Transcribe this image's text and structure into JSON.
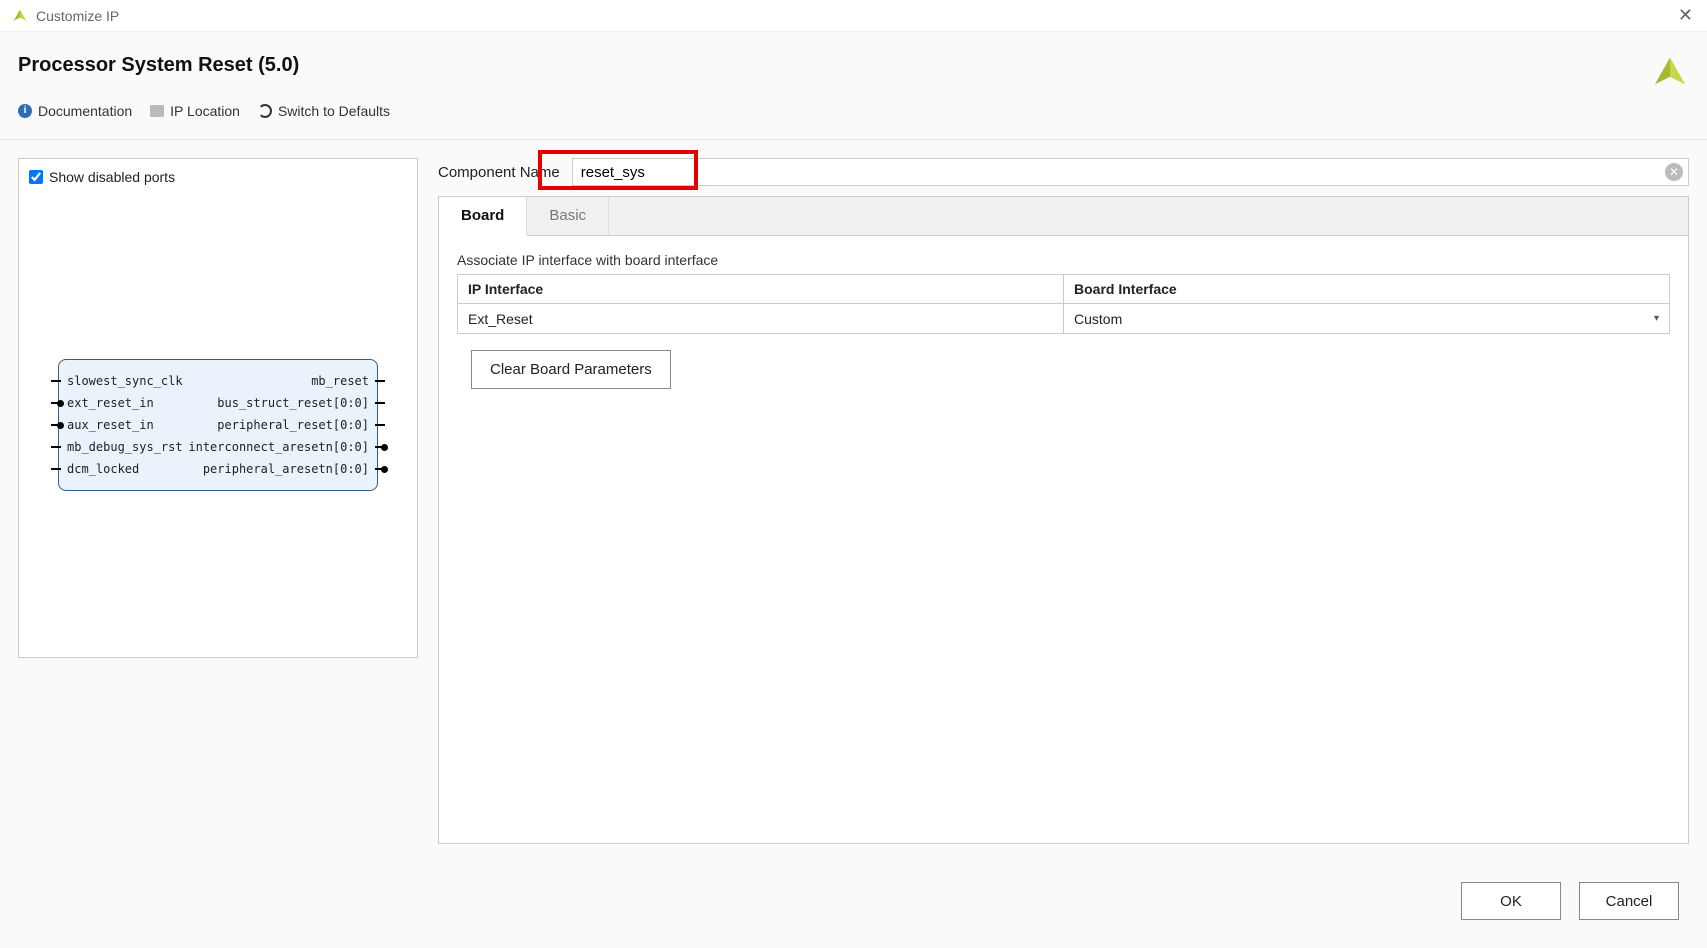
{
  "window": {
    "title": "Customize IP"
  },
  "header": {
    "page_title": "Processor System Reset (5.0)",
    "links": {
      "documentation": "Documentation",
      "ip_location": "IP Location",
      "switch_defaults": "Switch to Defaults"
    }
  },
  "preview": {
    "show_disabled_label": "Show disabled ports",
    "show_disabled_checked": true,
    "inputs": [
      {
        "name": "slowest_sync_clk",
        "dot": false
      },
      {
        "name": "ext_reset_in",
        "dot": true
      },
      {
        "name": "aux_reset_in",
        "dot": true
      },
      {
        "name": "mb_debug_sys_rst",
        "dot": false
      },
      {
        "name": "dcm_locked",
        "dot": false
      }
    ],
    "outputs": [
      {
        "name": "mb_reset",
        "dot": false
      },
      {
        "name": "bus_struct_reset[0:0]",
        "dot": false
      },
      {
        "name": "peripheral_reset[0:0]",
        "dot": false
      },
      {
        "name": "interconnect_aresetn[0:0]",
        "dot": true
      },
      {
        "name": "peripheral_aresetn[0:0]",
        "dot": true
      }
    ]
  },
  "form": {
    "component_name_label": "Component Name",
    "component_name_value": "reset_sys"
  },
  "tabs": {
    "board": "Board",
    "basic": "Basic",
    "active": "board"
  },
  "board": {
    "associate_label": "Associate IP interface with board interface",
    "columns": {
      "ip_interface": "IP Interface",
      "board_interface": "Board Interface"
    },
    "rows": [
      {
        "ip_interface": "Ext_Reset",
        "board_interface": "Custom"
      }
    ],
    "clear_button": "Clear Board Parameters"
  },
  "footer": {
    "ok": "OK",
    "cancel": "Cancel"
  }
}
